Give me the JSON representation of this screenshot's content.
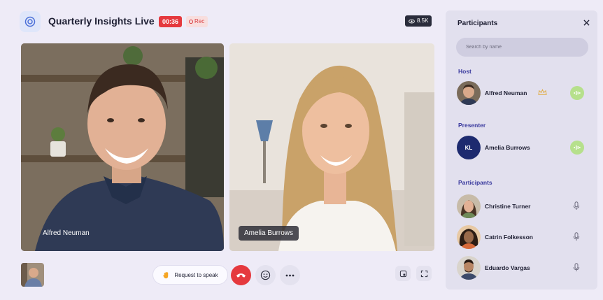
{
  "header": {
    "title": "Quarterly Insights Live",
    "timer": "00:36",
    "rec_label": "Rec",
    "viewer_count": "8.5K"
  },
  "stage": {
    "tiles": [
      {
        "name": "Alfred Neuman"
      },
      {
        "name": "Amelia Burrows"
      }
    ]
  },
  "controls": {
    "request_label": "Request to speak"
  },
  "panel": {
    "title": "Participants",
    "search_placeholder": "Search by name",
    "sections": {
      "host": "Host",
      "presenter": "Presenter",
      "participants": "Participants"
    },
    "host": {
      "name": "Alfred Neuman",
      "speaking": true
    },
    "presenter": {
      "name": "Amelia Burrows",
      "initials": "KL",
      "speaking": true
    },
    "participants": [
      {
        "name": "Christine Turner",
        "icon": "mic-icon"
      },
      {
        "name": "Catrin Folkesson",
        "icon": "mic-icon"
      },
      {
        "name": "Eduardo Vargas",
        "icon": "mic-icon"
      }
    ]
  },
  "colors": {
    "accent_red": "#e5393e",
    "section_blue": "#3a3a9e",
    "speaking_green": "#b6e08c"
  }
}
